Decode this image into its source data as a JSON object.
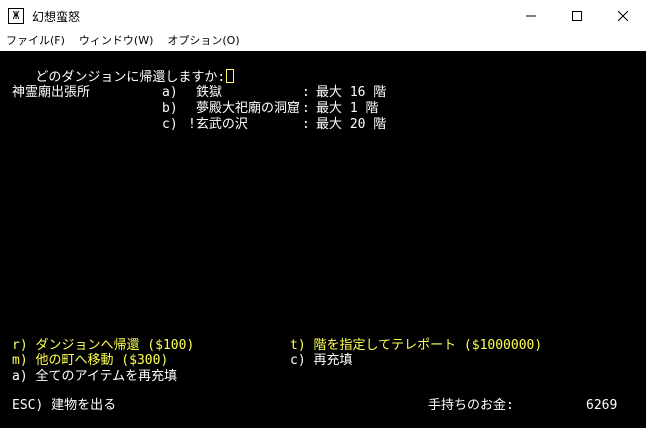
{
  "window": {
    "title": "幻想蛮怒",
    "icon_glyph": "Ж",
    "controls": {
      "minimize": "minimize-icon",
      "maximize": "maximize-icon",
      "close": "close-icon"
    }
  },
  "menubar": {
    "items": [
      {
        "label": "ファイル(F)"
      },
      {
        "label": "ウィンドウ(W)"
      },
      {
        "label": "オプション(O)"
      }
    ]
  },
  "terminal": {
    "prompt": "どのダンジョンに帰還しますか:",
    "location": "神霊廟出張所",
    "dungeons": [
      {
        "key": "a)",
        "name": "鉄獄",
        "sep": ":",
        "max": "最大 16 階"
      },
      {
        "key": "b)",
        "name": "夢殿大祀廟の洞窟",
        "sep": ":",
        "max": "最大 1 階"
      },
      {
        "key": "c)",
        "name": "!玄武の沢",
        "sep": ":",
        "max": "最大 20 階"
      }
    ],
    "commands": {
      "r": "r) ダンジョンへ帰還 ($100)",
      "t": "t) 階を指定してテレポート ($1000000)",
      "m": "m) 他の町へ移動 ($300)",
      "c": "c) 再充填",
      "a": "a) 全てのアイテムを再充填",
      "esc": "ESC) 建物を出る"
    },
    "gold_label": "手持ちのお金:",
    "gold_value": "6269",
    "colors": {
      "background": "#000000",
      "text": "#ffffff",
      "highlight": "#ffff55"
    }
  }
}
